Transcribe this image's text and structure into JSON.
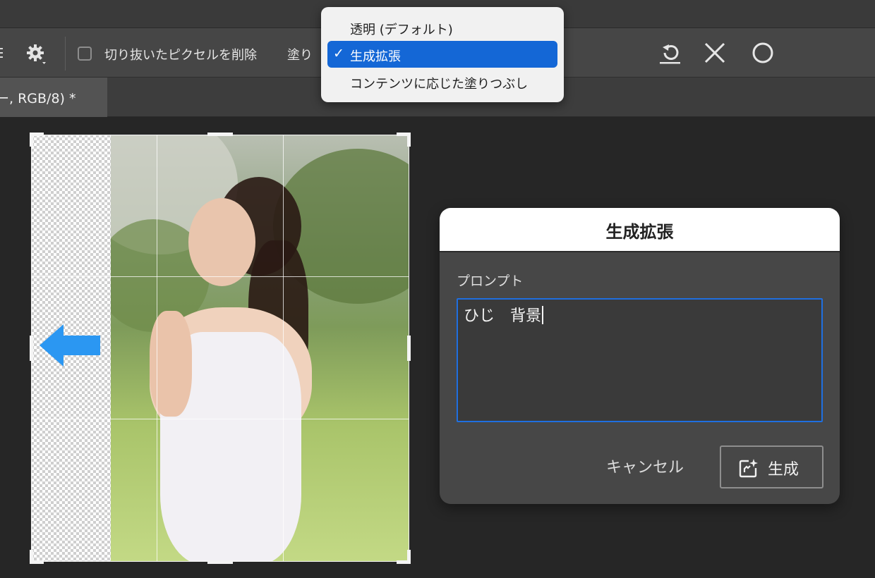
{
  "options_bar": {
    "delete_cropped_label": "切り抜いたピクセルを削除",
    "fill_label": "塗り",
    "settings_icon": "gear-icon",
    "reset_icon": "reset-icon",
    "cancel_icon": "close-icon",
    "commit_icon": "circle-commit-icon"
  },
  "document_tab": {
    "title": "ー, RGB/8) *"
  },
  "fill_menu": {
    "items": [
      {
        "label": "透明 (デフォルト)",
        "selected": false
      },
      {
        "label": "生成拡張",
        "selected": true
      },
      {
        "label": "コンテンツに応じた塗りつぶし",
        "selected": false
      }
    ],
    "check_mark": "✓"
  },
  "dialog": {
    "title": "生成拡張",
    "prompt_label": "プロンプト",
    "prompt_value": "ひじ　背景",
    "cancel_label": "キャンセル",
    "generate_label": "生成",
    "generate_icon": "generate-sparkle-icon"
  },
  "colors": {
    "accent": "#1467d6",
    "arrow": "#2b97f2",
    "input_border": "#1f6fe0"
  }
}
